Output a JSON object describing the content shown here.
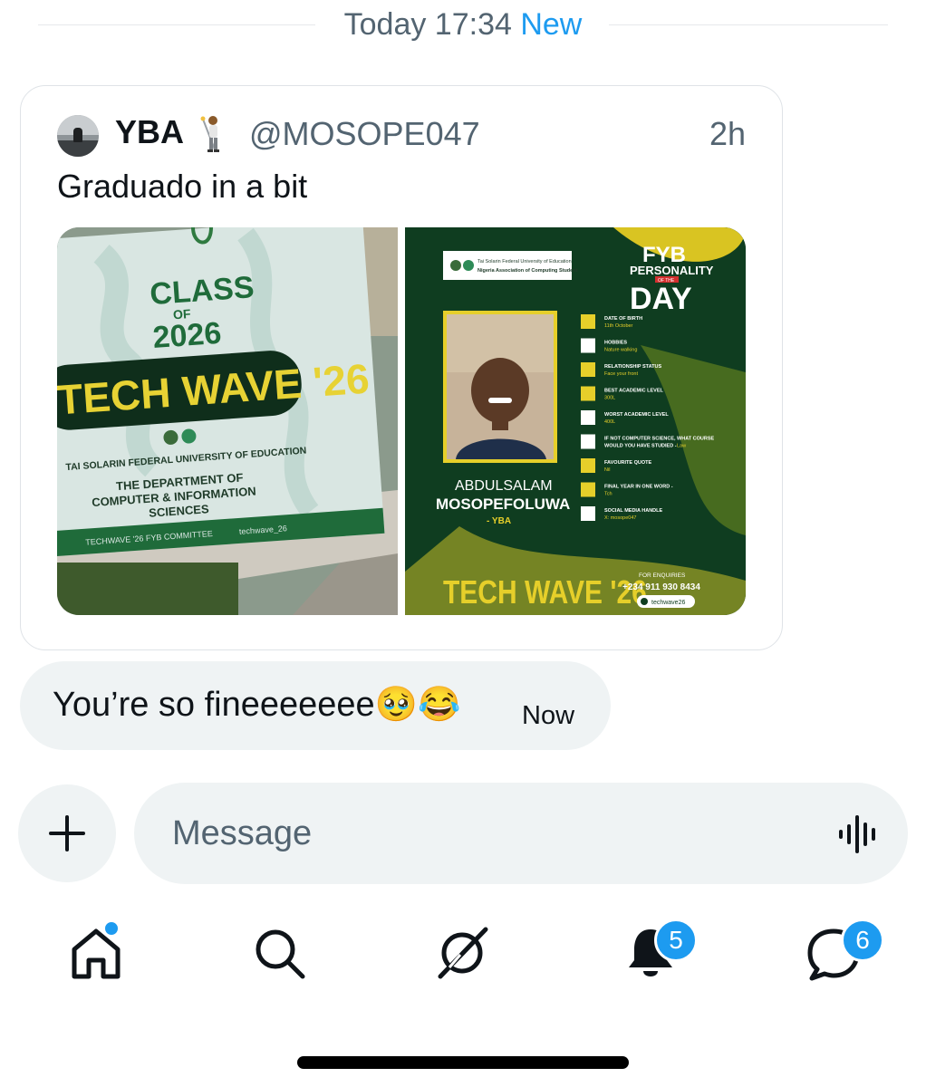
{
  "divider": {
    "time": "Today 17:34",
    "new_label": "New"
  },
  "quote": {
    "author_name": "YBA",
    "author_emoji": "🏌🏾",
    "handle": "@MOSOPE047",
    "time": "2h",
    "text": "Graduado in a bit",
    "photo": {
      "class_line1": "CLASS",
      "class_line2": "OF",
      "class_line3": "2026",
      "banner": "TECH WAVE '26",
      "university": "TAI SOLARIN FEDERAL UNIVERSITY OF EDUCATION",
      "dept_line1": "THE DEPARTMENT OF",
      "dept_line2": "COMPUTER & INFORMATION",
      "dept_line3": "SCIENCES",
      "committee": "TECHWAVE '26 FYB COMMITTEE",
      "social": "techwave_26"
    },
    "poster": {
      "univ": "Tai Solarin Federal University of Education",
      "assoc": "Nigeria Association of Computing Student",
      "fyb": "FYB",
      "personality": "PERSONALITY",
      "of_the": "OF THE",
      "day": "DAY",
      "name_first": "ABDULSALAM",
      "name_last": "MOSOPEFOLUWA",
      "nick": "- YBA",
      "banner": "TECH WAVE '26",
      "enquiries": "FOR ENQUIRIES",
      "phone": "+234 911 930 8434",
      "social": "techwave26",
      "details": [
        {
          "label": "DATE OF BIRTH",
          "value": "11th October"
        },
        {
          "label": "HOBBIES",
          "value": "Nature walking"
        },
        {
          "label": "RELATIONSHIP STATUS",
          "value": "Face your front"
        },
        {
          "label": "BEST ACADEMIC LEVEL",
          "value": "300L"
        },
        {
          "label": "WORST ACADEMIC LEVEL",
          "value": "400L"
        },
        {
          "label": "IF NOT COMPUTER SCIENCE, WHAT COURSE",
          "label2": "WOULD YOU HAVE STUDIED -",
          "value": "Law"
        },
        {
          "label": "FAVOURITE QUOTE",
          "value": "Nil"
        },
        {
          "label": "FINAL YEAR IN ONE WORD -",
          "value": "Tch"
        },
        {
          "label": "SOCIAL MEDIA HANDLE",
          "value": "X: mosope047"
        }
      ]
    }
  },
  "reply": {
    "text": "You’re so fineeeeeee🥹😂",
    "time": "Now"
  },
  "composer": {
    "placeholder": "Message"
  },
  "nav": {
    "notifications_badge": "5",
    "messages_badge": "6"
  }
}
